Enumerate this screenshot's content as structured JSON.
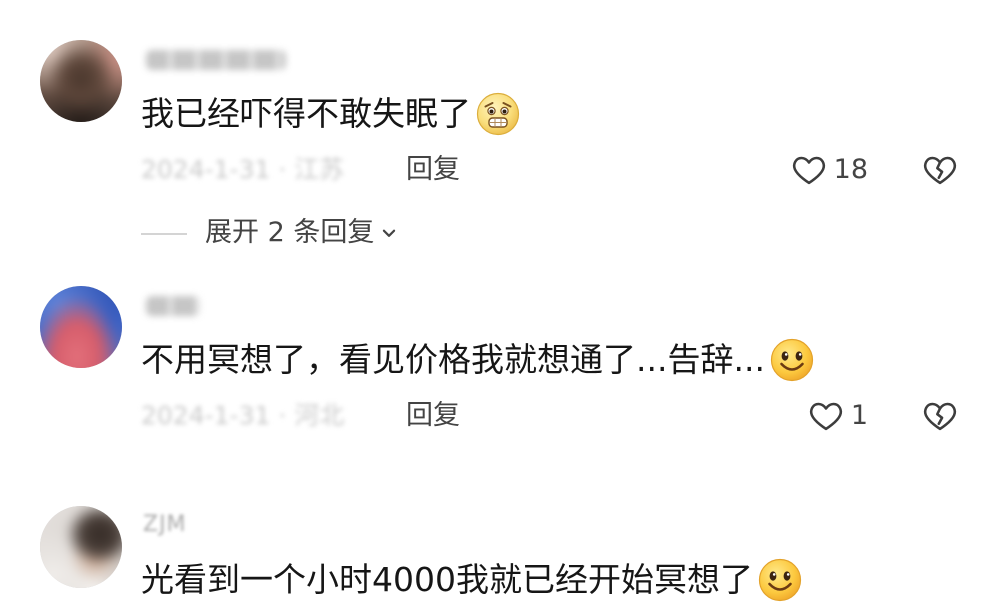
{
  "comments": [
    {
      "text": "我已经吓得不敢失眠了",
      "emoji": "fearful-face-emoji",
      "meta": "2024-1-31 · 江苏",
      "reply_label": "回复",
      "like_count": "18"
    },
    {
      "text": "不用冥想了，看见价格我就想通了...告辞...",
      "emoji": "smiling-face-emoji",
      "meta": "2024-1-31 · 河北",
      "reply_label": "回复",
      "like_count": "1"
    },
    {
      "username": "ZJM",
      "text": "光看到一个小时4000我就已经开始冥想了",
      "emoji": "smiling-face-emoji"
    }
  ],
  "expand_replies": {
    "label": "展开 2 条回复"
  },
  "icons": {
    "like": "heart-outline-icon",
    "dislike": "broken-heart-icon",
    "expand": "chevron-down-icon"
  },
  "colors": {
    "background": "#ffffff",
    "text": "#161616",
    "secondary_text": "#444444",
    "muted_text": "#c9c9c9",
    "emoji_yellow": "#fcc93f"
  }
}
